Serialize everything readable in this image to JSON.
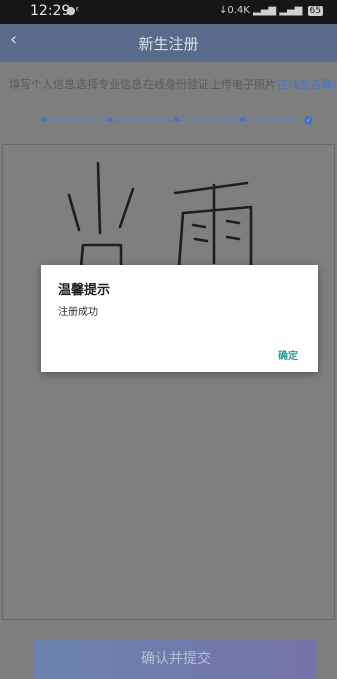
{
  "status_bar": {
    "time": "12:29",
    "right_text": "↓0.4K",
    "battery": "65"
  },
  "header": {
    "back_glyph": "‹",
    "title": "新生注册"
  },
  "steps": [
    {
      "label": "填写个人信息",
      "active": false
    },
    {
      "label": "选择专业信息",
      "active": false
    },
    {
      "label": "在线身份验证",
      "active": false
    },
    {
      "label": "上传电子照片",
      "active": false
    },
    {
      "label": "在线签名确认",
      "active": true
    }
  ],
  "dialog": {
    "title": "温馨提示",
    "message": "注册成功",
    "confirm_label": "确定"
  },
  "submit": {
    "label": "确认并提交"
  },
  "colors": {
    "accent": "#4c74c0",
    "ok": "#2a9d8f"
  }
}
